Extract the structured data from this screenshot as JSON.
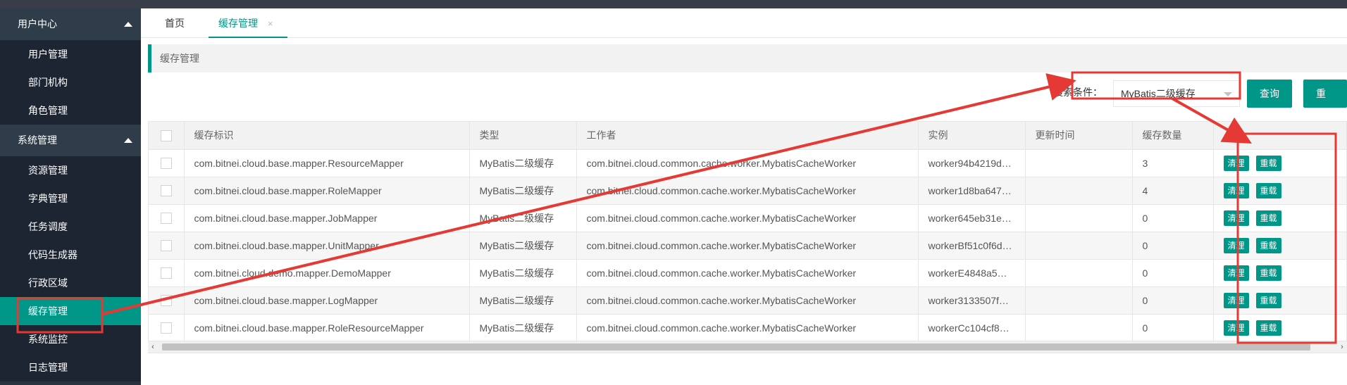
{
  "sidebar": {
    "groups": [
      {
        "label": "用户中心",
        "items": [
          "用户管理",
          "部门机构",
          "角色管理"
        ]
      },
      {
        "label": "系统管理",
        "items": [
          "资源管理",
          "字典管理",
          "任务调度",
          "代码生成器",
          "行政区域",
          "缓存管理",
          "系统监控",
          "日志管理"
        ]
      }
    ],
    "active_item": "缓存管理"
  },
  "tabs": [
    {
      "label": "首页"
    },
    {
      "label": "缓存管理",
      "close": "×"
    }
  ],
  "breadcrumb": "缓存管理",
  "search": {
    "label": "搜索条件：",
    "selected": "MyBatis二级缓存",
    "query_button": "查询",
    "reset_button": "重置"
  },
  "table": {
    "headers": [
      "缓存标识",
      "类型",
      "工作者",
      "实例",
      "更新时间",
      "缓存数量"
    ],
    "rows": [
      [
        "com.bitnei.cloud.base.mapper.ResourceMapper",
        "MyBatis二级缓存",
        "com.bitnei.cloud.common.cache.worker.MybatisCacheWorker",
        "worker94b4219d…",
        "",
        "3"
      ],
      [
        "com.bitnei.cloud.base.mapper.RoleMapper",
        "MyBatis二级缓存",
        "com.bitnei.cloud.common.cache.worker.MybatisCacheWorker",
        "worker1d8ba647…",
        "",
        "4"
      ],
      [
        "com.bitnei.cloud.base.mapper.JobMapper",
        "MyBatis二级缓存",
        "com.bitnei.cloud.common.cache.worker.MybatisCacheWorker",
        "worker645eb31e…",
        "",
        "0"
      ],
      [
        "com.bitnei.cloud.base.mapper.UnitMapper",
        "MyBatis二级缓存",
        "com.bitnei.cloud.common.cache.worker.MybatisCacheWorker",
        "workerBf51c0f6d…",
        "",
        "0"
      ],
      [
        "com.bitnei.cloud.demo.mapper.DemoMapper",
        "MyBatis二级缓存",
        "com.bitnei.cloud.common.cache.worker.MybatisCacheWorker",
        "workerE4848a5…",
        "",
        "0"
      ],
      [
        "com.bitnei.cloud.base.mapper.LogMapper",
        "MyBatis二级缓存",
        "com.bitnei.cloud.common.cache.worker.MybatisCacheWorker",
        "worker3133507f…",
        "",
        "0"
      ],
      [
        "com.bitnei.cloud.base.mapper.RoleResourceMapper",
        "MyBatis二级缓存",
        "com.bitnei.cloud.common.cache.worker.MybatisCacheWorker",
        "workerCc104cf8…",
        "",
        "0"
      ]
    ],
    "row_actions": [
      "清理",
      "重载"
    ]
  },
  "scrollbar": {
    "left_arrow": "‹",
    "right_arrow": "›"
  },
  "colors": {
    "accent": "#009688",
    "sidebar_bg": "#28333e",
    "annotation": "#e53935"
  }
}
